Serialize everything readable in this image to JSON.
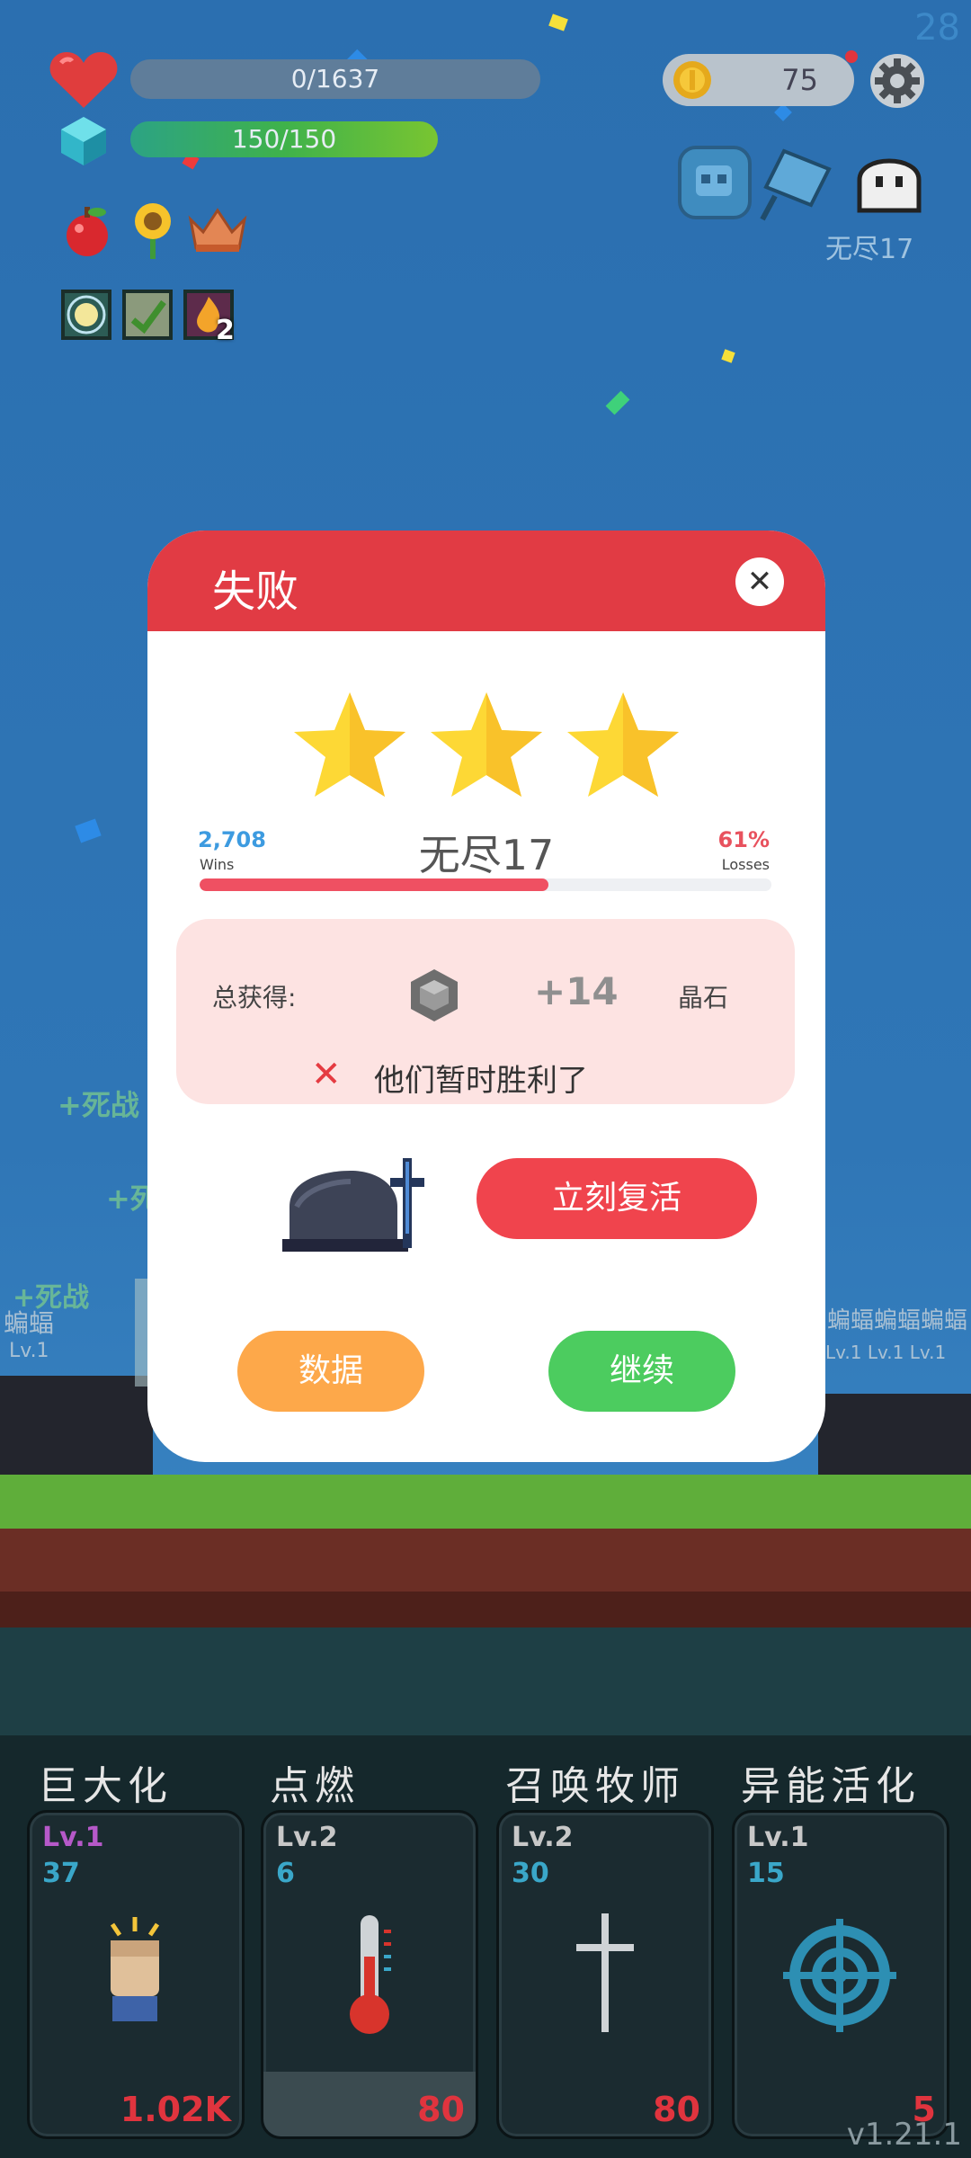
{
  "hud": {
    "fps": "28",
    "health_text": "0/1637",
    "mana_text": "150/150",
    "coins": "75",
    "stage_label": "无尽17",
    "item_icons": [
      "apple-icon",
      "sunflower-icon",
      "crown-icon"
    ],
    "buff_icons": [
      "light-buff-icon",
      "leaf-buff-icon",
      "fire-buff-icon"
    ],
    "buff_stack": "2",
    "avatar_icons": [
      "ghost-skull-icon",
      "flag-icon",
      "ghost-icon"
    ]
  },
  "battlefield": {
    "floating_texts": [
      "+死战",
      "+死",
      "+死战"
    ],
    "enemy_labels": [
      "蝙蝠",
      "蝙蝠蝙蝠蝙蝠",
      "Lv.1",
      "Lv.1 Lv.1 Lv.1"
    ]
  },
  "dialog": {
    "title": "失败",
    "close_icon": "close-icon",
    "stars": 3,
    "wins_value": "2,708",
    "wins_label": "Wins",
    "stage": "无尽17",
    "losses_value": "61%",
    "losses_label": "Losses",
    "loss_ratio": 0.61,
    "reward_label": "总获得:",
    "reward_icon": "crystal-icon",
    "reward_amount": "+14",
    "reward_unit": "晶石",
    "lose_message": "他们暂时胜利了",
    "revive_button": "立刻复活",
    "stats_button": "数据",
    "continue_button": "继续"
  },
  "skills": [
    {
      "name": "巨大化",
      "level": "Lv.1",
      "count": "37",
      "cost": "1.02K",
      "icon": "fist-icon"
    },
    {
      "name": "点燃",
      "level": "Lv.2",
      "count": "6",
      "cost": "80",
      "icon": "thermometer-icon"
    },
    {
      "name": "召唤牧师",
      "level": "Lv.2",
      "count": "30",
      "cost": "80",
      "icon": "cross-icon"
    },
    {
      "name": "异能活化",
      "level": "Lv.1",
      "count": "15",
      "cost": "5",
      "icon": "target-icon"
    }
  ],
  "version": "v1.21.1",
  "colors": {
    "sky": "#2f73b2",
    "dialog_header": "#e13b44",
    "revive": "#f0444d",
    "stats": "#fda84a",
    "continue": "#4ccc5f",
    "star": "#fdd835"
  }
}
